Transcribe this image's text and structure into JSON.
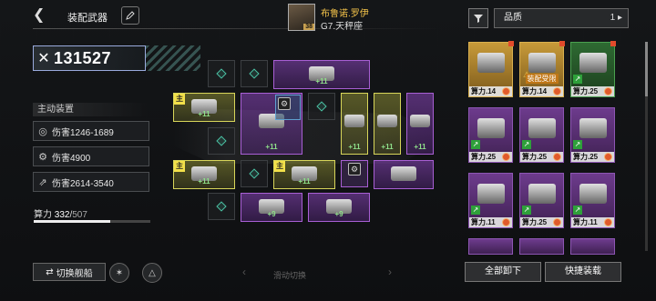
{
  "header": {
    "back_icon": "back-chevron-icon",
    "title": "装配武器",
    "edit_icon": "pen-icon"
  },
  "captain": {
    "name": "布鲁诺.罗伊",
    "rank": "G7.天秤座",
    "level": "38"
  },
  "power": {
    "value": "131527",
    "icon": "crossed-swords-icon"
  },
  "stats": {
    "section_title": "主动装置",
    "rows": [
      {
        "icon": "target-icon",
        "text": "伤害1246-1689"
      },
      {
        "icon": "gear-target-icon",
        "text": "伤害4900"
      },
      {
        "icon": "missiles-icon",
        "text": "伤害2614-3540"
      }
    ]
  },
  "calc": {
    "label": "算力",
    "current": "332",
    "max": "507",
    "fraction": 0.655
  },
  "footer": {
    "switch_ship": "切换舰船",
    "slide_switch": "滑动切换",
    "unload_all": "全部卸下",
    "quick_equip": "快捷装载"
  },
  "filter": {
    "icon": "filter-icon",
    "quality_label": "品质",
    "quality_count": "1"
  },
  "slot_labels": {
    "main": "主",
    "p11": "+11",
    "p9": "+9"
  },
  "cards": [
    {
      "label": "算力.14",
      "color": "gold",
      "note": ""
    },
    {
      "label": "算力.14",
      "color": "gold",
      "note": "装配受限"
    },
    {
      "label": "算力.25",
      "color": "green",
      "note": ""
    },
    {
      "label": "算力.25",
      "color": "purple",
      "note": ""
    },
    {
      "label": "算力.25",
      "color": "purple",
      "note": ""
    },
    {
      "label": "算力.25",
      "color": "purple",
      "note": ""
    },
    {
      "label": "算力.11",
      "color": "purple",
      "note": ""
    },
    {
      "label": "算力.25",
      "color": "purple",
      "note": ""
    },
    {
      "label": "算力.11",
      "color": "purple",
      "note": ""
    }
  ]
}
